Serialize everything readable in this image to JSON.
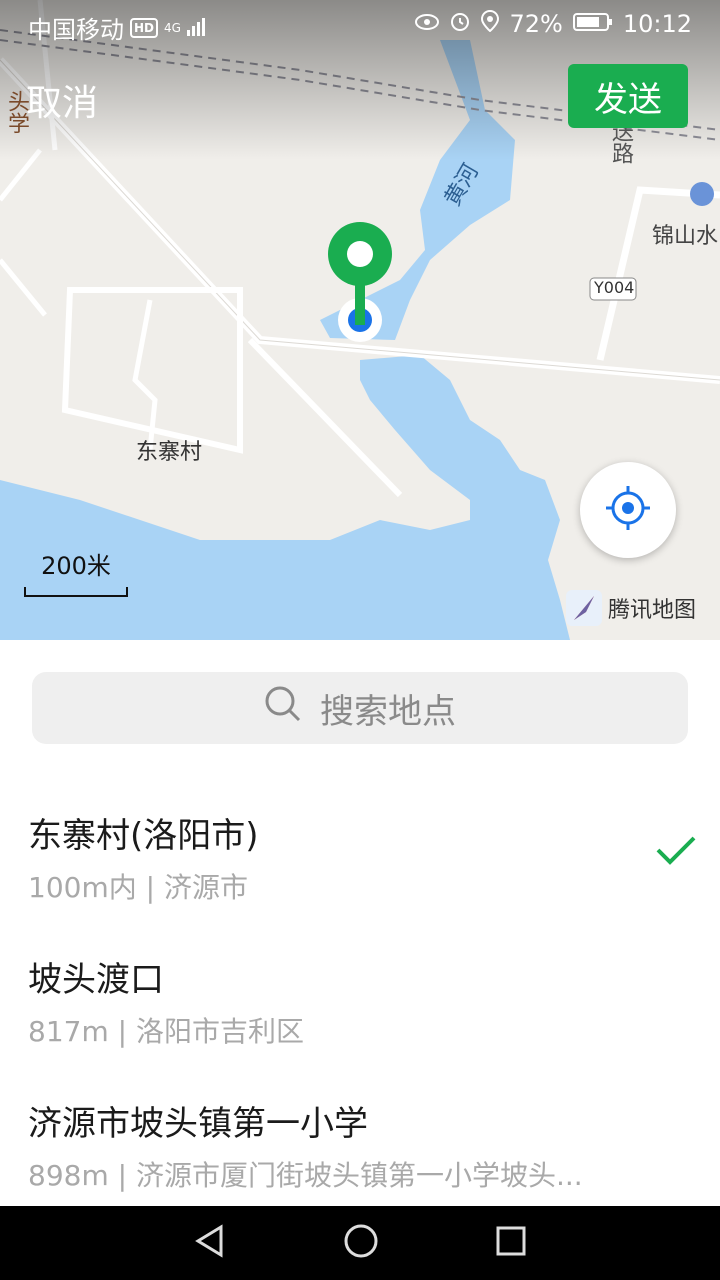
{
  "status_bar": {
    "carrier": "中国移动",
    "hd": "HD",
    "network": "4G",
    "battery": "72%",
    "time": "10:12"
  },
  "header": {
    "cancel_label": "取消",
    "send_label": "发送"
  },
  "map": {
    "labels": {
      "village": "东寨村",
      "river": "黄河",
      "road": "Y004",
      "poi": "锦山水",
      "road_top_right": "送路",
      "left_edge": "头学"
    },
    "scale_label": "200米",
    "provider": "腾讯地图"
  },
  "search": {
    "placeholder": "搜索地点"
  },
  "places": [
    {
      "name": "东寨村(洛阳市)",
      "detail": "100m内 | 济源市",
      "selected": true
    },
    {
      "name": "坡头渡口",
      "detail": "817m | 洛阳市吉利区",
      "selected": false
    },
    {
      "name": "济源市坡头镇第一小学",
      "detail": "898m | 济源市厦门街坡头镇第一小学坡头...",
      "selected": false
    }
  ],
  "colors": {
    "accent": "#1aad50",
    "water": "#a9d3f5",
    "location_blue": "#1a73e8"
  }
}
